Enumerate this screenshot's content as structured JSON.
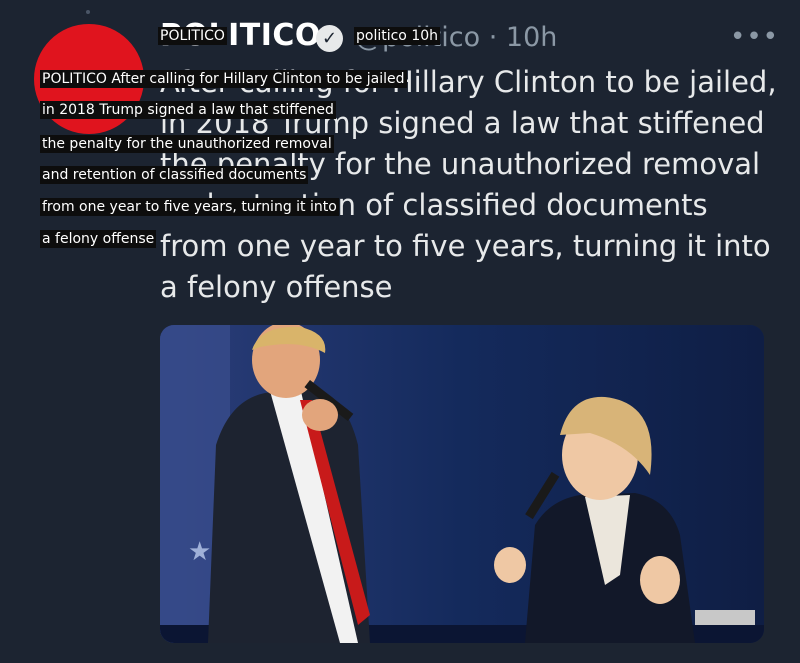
{
  "tweet": {
    "author": "POLITICO",
    "verified": true,
    "handle": "@politico",
    "time": "10h",
    "lines": [
      "After calling for Hillary Clinton to be jailed,",
      "in 2018 Trump signed a law that stiffened",
      "the penalty for the unauthorized removal",
      "and retention of classified documents",
      "from one year to five years, turning it into",
      "a felony offense"
    ],
    "more_icon": "more-horizontal-icon"
  },
  "header_prefix": "PO",
  "overlay": {
    "author_label": "POLITICO",
    "meta_label": "politico 10h",
    "lines": [
      "POLITICO After calling for Hillary Clinton to be jailed",
      "in 2018 Trump signed a law that stiffened",
      "the penalty for the unauthorized removal",
      "and retention of classified documents",
      "from one year to five years, turning it into",
      "a felony offense"
    ]
  },
  "colors": {
    "background": "#1c2431",
    "avatar": "#e0141e",
    "text": "#e7e9ea",
    "muted": "#8b98a5"
  }
}
